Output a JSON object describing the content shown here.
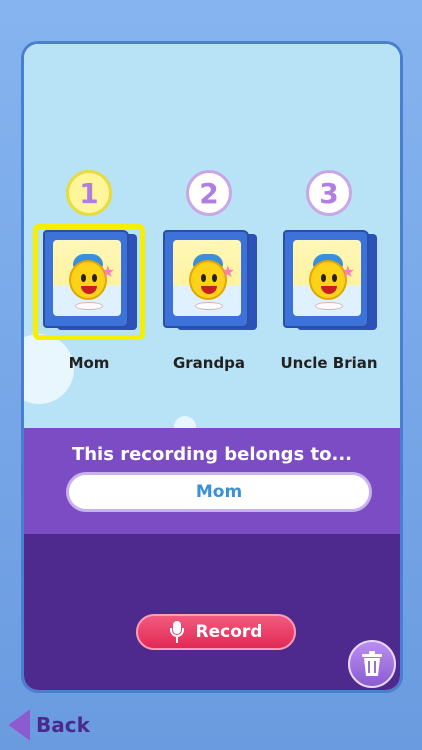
{
  "slots": [
    {
      "number": "1",
      "name": "Mom",
      "selected": true
    },
    {
      "number": "2",
      "name": "Grandpa",
      "selected": false
    },
    {
      "number": "3",
      "name": "Uncle Brian",
      "selected": false
    }
  ],
  "belongs": {
    "label": "This recording belongs to...",
    "owner_value": "Mom"
  },
  "actions": {
    "record_label": "Record",
    "trash_icon": "trash-icon",
    "mic_icon": "microphone-icon"
  },
  "navigation": {
    "back_label": "Back",
    "back_icon": "back-arrow-icon"
  },
  "colors": {
    "accent_purple": "#7b4cc3",
    "dark_purple": "#4e2a8e",
    "record_red": "#e22955",
    "selected_yellow": "#f6f000",
    "sky": "#b8e3f6"
  }
}
